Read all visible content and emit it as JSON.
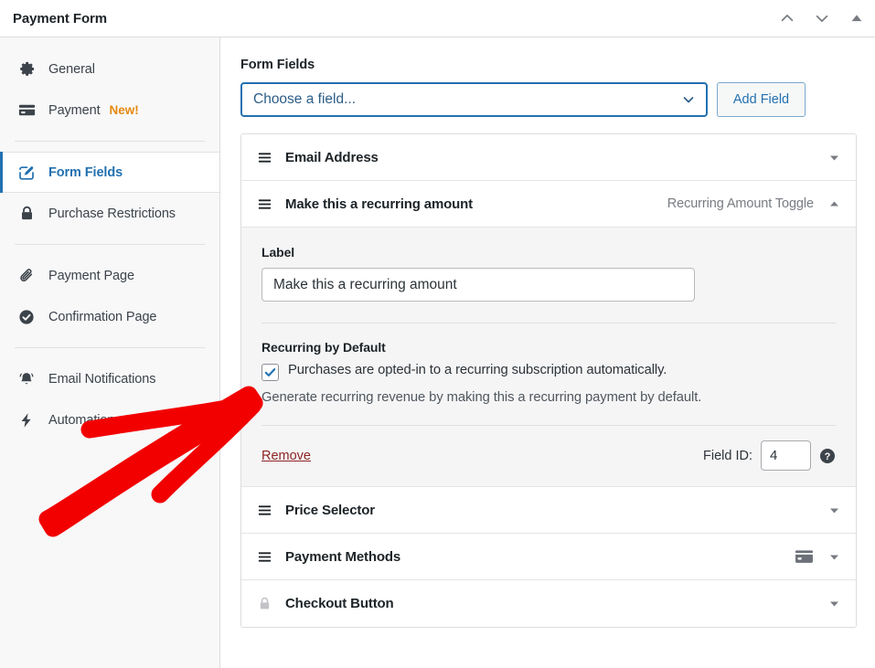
{
  "window": {
    "title": "Payment Form",
    "controls": [
      {
        "name": "chevron-up-icon",
        "label": "Move up"
      },
      {
        "name": "chevron-down-icon",
        "label": "Move down"
      },
      {
        "name": "collapse-triangle-icon",
        "label": "Collapse"
      }
    ]
  },
  "sidebar": {
    "groups": [
      {
        "items": [
          {
            "label": "General",
            "icon": "gear-icon",
            "badge": "",
            "active": false
          },
          {
            "label": "Payment",
            "icon": "credit-card-icon",
            "badge": "New!",
            "active": false
          }
        ]
      },
      {
        "items": [
          {
            "label": "Form Fields",
            "icon": "edit-square-icon",
            "badge": "",
            "active": true
          },
          {
            "label": "Purchase Restrictions",
            "icon": "lock-icon",
            "badge": "",
            "active": false
          }
        ]
      },
      {
        "items": [
          {
            "label": "Payment Page",
            "icon": "paperclip-icon",
            "badge": "",
            "active": false
          },
          {
            "label": "Confirmation Page",
            "icon": "check-circle-icon",
            "badge": "",
            "active": false
          }
        ]
      },
      {
        "items": [
          {
            "label": "Email Notifications",
            "icon": "bell-icon",
            "badge": "",
            "active": false
          },
          {
            "label": "Automations",
            "icon": "lightning-bolt-icon",
            "badge": "",
            "active": false
          }
        ]
      }
    ]
  },
  "main": {
    "section_title": "Form Fields",
    "field_select": {
      "value": "Choose a field...",
      "chevron": "chevron-down-icon"
    },
    "add_field_button": "Add Field",
    "fields": [
      {
        "name": "Email Address",
        "type": "",
        "handle": "drag-handle-icon",
        "badge_icon": "",
        "expanded": false,
        "caret": "caret-down-icon"
      },
      {
        "name": "Make this a recurring amount",
        "type": "Recurring Amount Toggle",
        "handle": "drag-handle-icon",
        "badge_icon": "",
        "expanded": true,
        "caret": "caret-up-icon"
      },
      {
        "name": "Price Selector",
        "type": "",
        "handle": "drag-handle-icon",
        "badge_icon": "",
        "expanded": false,
        "caret": "caret-down-icon"
      },
      {
        "name": "Payment Methods",
        "type": "",
        "handle": "drag-handle-icon",
        "badge_icon": "credit-card-icon",
        "expanded": false,
        "caret": "caret-down-icon"
      },
      {
        "name": "Checkout Button",
        "type": "",
        "handle": "lock-icon",
        "badge_icon": "",
        "expanded": false,
        "caret": "caret-down-icon"
      }
    ],
    "expanded_panel": {
      "label_heading": "Label",
      "label_value": "Make this a recurring amount",
      "recurring_heading": "Recurring by Default",
      "checkbox_checked": true,
      "checkbox_text": "Purchases are opted-in to a recurring subscription automatically.",
      "help_text": "Generate recurring revenue by making this a recurring payment by default.",
      "remove_link": "Remove",
      "field_id_label": "Field ID:",
      "field_id_value": "4",
      "help_icon": "question-circle-icon"
    }
  },
  "colors": {
    "accent": "#2271b1",
    "badge_new": "#e68a10",
    "remove_link": "#8d2424",
    "annotation_arrow": "#f20000",
    "panel_bg": "#f5f5f6"
  },
  "annotation": {
    "type": "hand-drawn-arrow",
    "color": "#f20000",
    "points_to": "recurring-by-default-checkbox"
  }
}
